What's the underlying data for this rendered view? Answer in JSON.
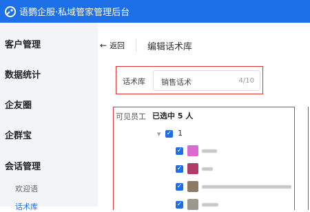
{
  "topbar": {
    "title": "语鹦企服·私域管家管理后台",
    "logo_icon": "parrot-logo-icon",
    "bg_color": "#1d6fe8"
  },
  "sidebar": {
    "items": [
      {
        "label": "客户管理"
      },
      {
        "label": "数据统计"
      },
      {
        "label": "企友圈"
      },
      {
        "label": "企群宝"
      },
      {
        "label": "会话管理"
      }
    ],
    "sub_items": [
      {
        "label": "欢迎语",
        "active": false
      },
      {
        "label": "话术库",
        "active": true
      }
    ]
  },
  "header": {
    "back_label": "返回",
    "back_icon": "arrow-left-icon",
    "page_title": "编辑话术库"
  },
  "library_field": {
    "label": "话术库",
    "value": "销售话术",
    "counter": "4/10"
  },
  "visible_staff": {
    "label": "可见员工",
    "selected_text": "已选中 5 人",
    "group": {
      "label": "1",
      "checked": true,
      "expanded": true
    },
    "members": [
      {
        "avatar_color": "#d86ad0",
        "checked": true
      },
      {
        "avatar_color": "#b23a6b",
        "checked": true
      },
      {
        "avatar_color": "#8d7a62",
        "checked": true
      },
      {
        "avatar_color": "#9a9a8c",
        "checked": true
      }
    ]
  },
  "colors": {
    "accent": "#1d6fe8",
    "highlight_border": "#e03030"
  }
}
